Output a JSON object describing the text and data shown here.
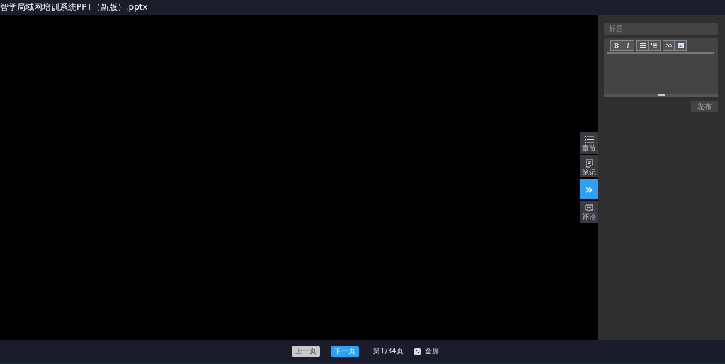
{
  "window": {
    "title": "智学局域网培训系统PPT（新版）.pptx"
  },
  "side_tabs": [
    {
      "kind": "tab",
      "label": "章节"
    },
    {
      "kind": "tab",
      "label": "笔记"
    },
    {
      "kind": "toggle",
      "label": "»",
      "expanded": true
    },
    {
      "kind": "tab",
      "label": "评论"
    }
  ],
  "note_panel": {
    "title_field": {
      "placeholder": "标题"
    },
    "toolbar": [
      [
        {
          "kind": "bold",
          "label": "B"
        },
        {
          "kind": "italic",
          "label": "I"
        }
      ],
      [
        {
          "kind": "icon"
        },
        {
          "kind": "icon"
        }
      ],
      [
        {
          "kind": "icon"
        },
        {
          "kind": "icon"
        }
      ]
    ],
    "publish_button": {
      "label": "发布",
      "disabled": true
    }
  },
  "pager": {
    "prev": {
      "label": "上一页",
      "disabled": true
    },
    "next": {
      "label": "下一页",
      "disabled": false
    },
    "page": "第1/34页",
    "fullscreen": "全屏"
  }
}
